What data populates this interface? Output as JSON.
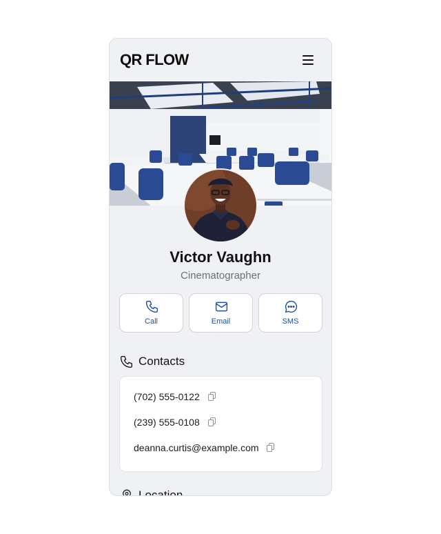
{
  "header": {
    "logo_text": "QR FLOW",
    "menu_icon": "hamburger-menu-icon"
  },
  "profile": {
    "name": "Victor Vaughn",
    "title": "Cinematographer"
  },
  "actions": [
    {
      "label": "Call",
      "icon": "phone-icon"
    },
    {
      "label": "Email",
      "icon": "envelope-icon"
    },
    {
      "label": "SMS",
      "icon": "chat-bubble-icon"
    }
  ],
  "contacts": {
    "heading": "Contacts",
    "items": [
      {
        "value": "(702) 555-0122"
      },
      {
        "value": "(239) 555-0108"
      },
      {
        "value": "deanna.curtis@example.com"
      }
    ]
  },
  "location": {
    "heading": "Location"
  },
  "colors": {
    "accent": "#1f4ea3",
    "background": "#eff1f5"
  }
}
